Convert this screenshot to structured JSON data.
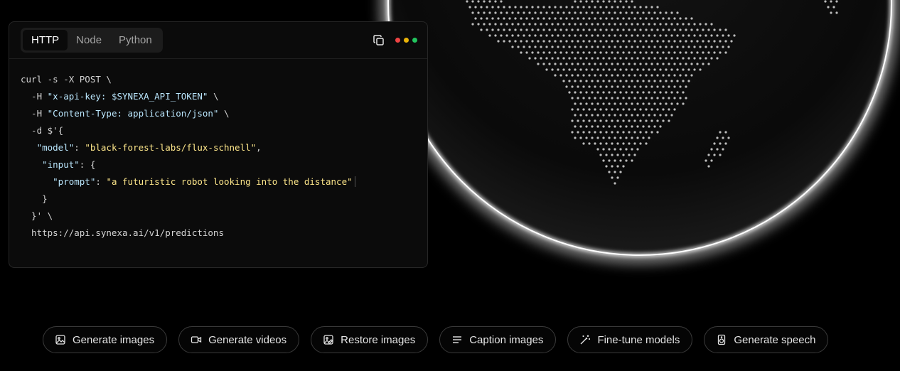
{
  "code_card": {
    "tabs": [
      {
        "label": "HTTP",
        "active": true
      },
      {
        "label": "Node",
        "active": false
      },
      {
        "label": "Python",
        "active": false
      }
    ],
    "copy_icon": "copy-icon",
    "window_dots": [
      "#ef4444",
      "#eab308",
      "#22c55e"
    ],
    "code": {
      "line1": "curl -s -X POST \\",
      "line2_flag": "  -H ",
      "line2_str": "\"x-api-key: $SYNEXA_API_TOKEN\"",
      "line2_end": " \\",
      "line3_flag": "  -H ",
      "line3_str": "\"Content-Type: application/json\"",
      "line3_end": " \\",
      "line4": "  -d $'{",
      "line5_indent": "   ",
      "line5_key": "\"model\"",
      "line5_sep": ": ",
      "line5_val": "\"black-forest-labs/flux-schnell\"",
      "line5_end": ",",
      "line6_indent": "    ",
      "line6_key": "\"input\"",
      "line6_end": ": {",
      "line7_indent": "      ",
      "line7_key": "\"prompt\"",
      "line7_sep": ": ",
      "line7_val": "\"a futuristic robot looking into the distance\"",
      "line8": "    }",
      "line9": "  }' \\",
      "line10": "  https://api.synexa.ai/v1/predictions"
    }
  },
  "pills": [
    {
      "label": "Generate images",
      "icon": "image-icon"
    },
    {
      "label": "Generate videos",
      "icon": "video-icon"
    },
    {
      "label": "Restore images",
      "icon": "image-restore-icon"
    },
    {
      "label": "Caption images",
      "icon": "text-lines-icon"
    },
    {
      "label": "Fine-tune models",
      "icon": "magic-wand-icon"
    },
    {
      "label": "Generate speech",
      "icon": "speaker-icon"
    }
  ]
}
